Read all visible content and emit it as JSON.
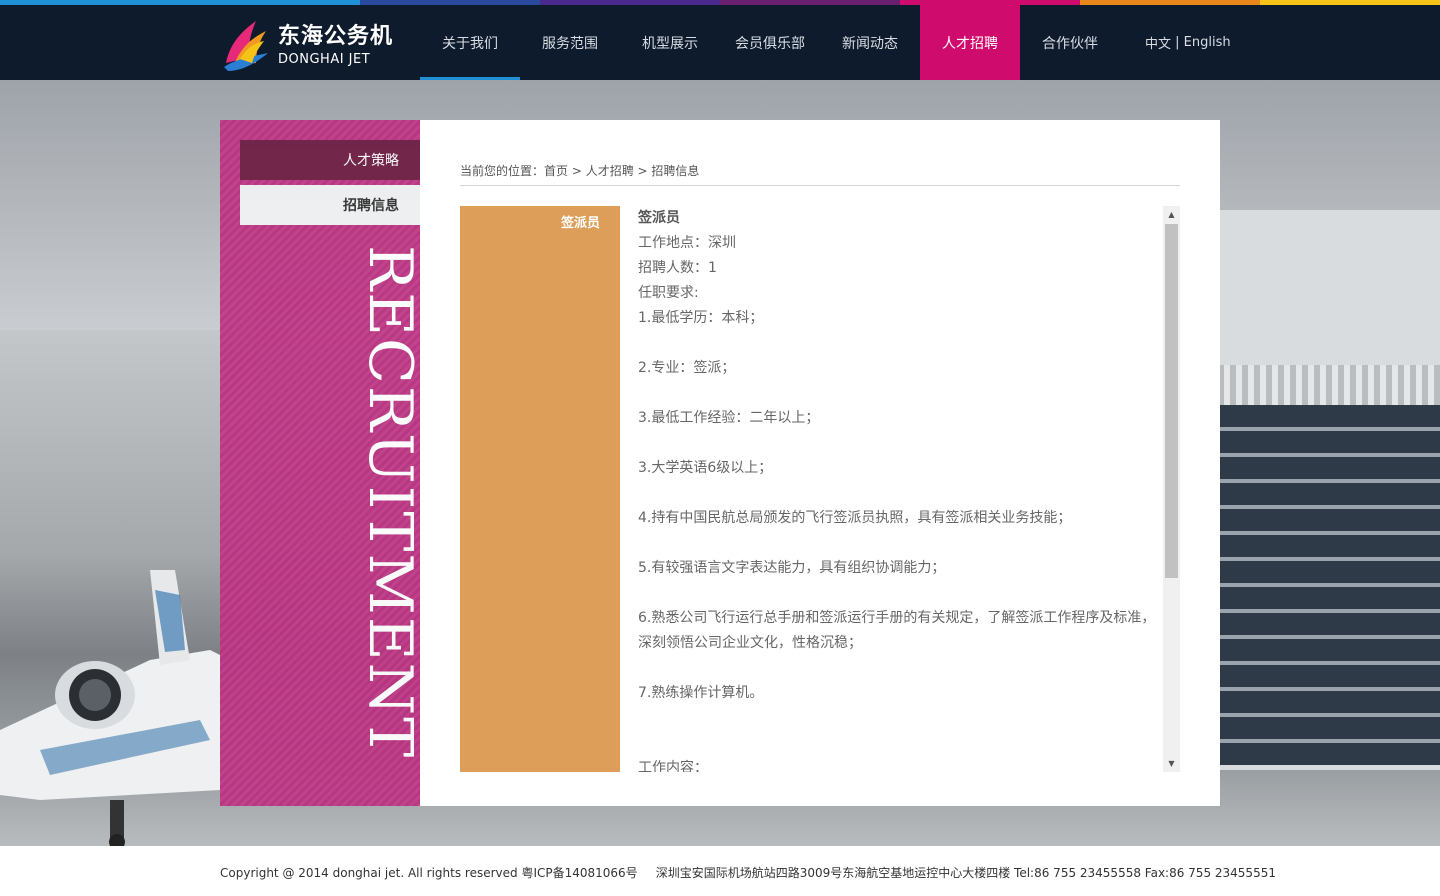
{
  "colors": {
    "strip": [
      "#1f8fd6",
      "#1f8fd6",
      "#2a4aa0",
      "#4a2a8c",
      "#6a1f6e",
      "#cf0b6d",
      "#e9871d",
      "#f5c417"
    ],
    "header_bg": "#0e1b2c",
    "nav_active": "#cf0b6d",
    "sidebar_magenta": "#c23d8a",
    "job_tab": "#dc9e58"
  },
  "logo": {
    "cn": "东海公务机",
    "en": "DONGHAI JET",
    "icon": "phoenix-logo-icon"
  },
  "nav": {
    "items": [
      "关于我们",
      "服务范围",
      "机型展示",
      "会员俱乐部",
      "新闻动态",
      "人才招聘",
      "合作伙伴"
    ],
    "active": "人才招聘"
  },
  "lang": {
    "cn": "中文",
    "sep": " | ",
    "en": "English"
  },
  "sidebar": {
    "items": [
      "人才策略",
      "招聘信息"
    ],
    "watermark": "RECRUITMENT"
  },
  "breadcrumb": {
    "prefix": "当前您的位置：",
    "home": "首页",
    "sep": " > ",
    "section": "人才招聘",
    "page": "招聘信息"
  },
  "job": {
    "tab_label": "签派员",
    "lines": [
      "签派员",
      "工作地点：深圳",
      "招聘人数：1",
      "任职要求:",
      "1.最低学历：本科；",
      "",
      "2.专业：签派；",
      "",
      "3.最低工作经验：二年以上；",
      "",
      "3.大学英语6级以上；",
      "",
      "4.持有中国民航总局颁发的飞行签派员执照，具有签派相关业务技能；",
      "",
      "5.有较强语言文字表达能力，具有组织协调能力；",
      "",
      "6.熟悉公司飞行运行总手册和签派运行手册的有关规定，了解签派工作程序及标准，深刻领悟公司企业文化，性格沉稳；",
      "",
      "7.熟练操作计算机。",
      "",
      "",
      "工作内容："
    ]
  },
  "footer": {
    "copyright": "Copyright @ 2014 donghai jet. All rights reserved 粤ICP备14081066号",
    "address": "深圳宝安国际机场航站四路3009号东海航空基地运控中心大楼四楼 Tel:86 755 23455558 Fax:86 755 23455551"
  }
}
